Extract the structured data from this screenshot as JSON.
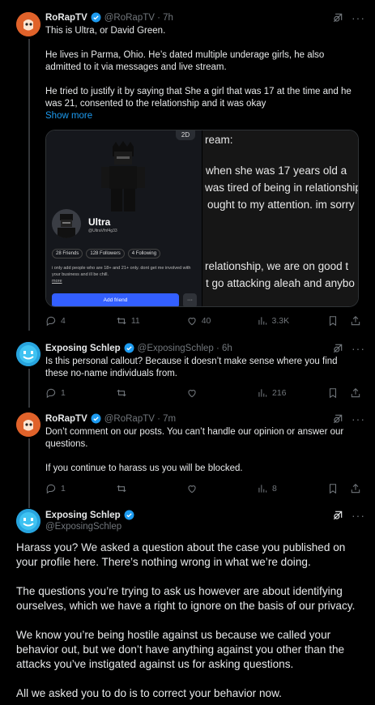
{
  "tweets": [
    {
      "author": "RoRapTV",
      "handle": "@RoRapTV · 7h",
      "text": "This is Ultra, or David Green.\n\nHe lives in Parma, Ohio. He’s dated multiple underage girls, he also admitted to it via messages and live stream.\n\nHe tried to justify it by saying that She a girl that was 17 at the time and he was 21, consented to the relationship and it was okay",
      "show_more": "Show more",
      "stats": {
        "replies": "4",
        "reposts": "11",
        "likes": "40",
        "views": "3.3K"
      }
    },
    {
      "author": "Exposing Schlep",
      "handle": "@ExposingSchlep · 6h",
      "text": "Is this personal callout? Because it doesn’t make sense where you find these no-name individuals from.",
      "stats": {
        "replies": "1",
        "reposts": "",
        "likes": "",
        "views": "216"
      }
    },
    {
      "author": "RoRapTV",
      "handle": "@RoRapTV · 7m",
      "text": "Don’t comment on our posts. You can’t handle our opinion or answer our questions.\n\nIf you continue to harass us you will be blocked.",
      "stats": {
        "replies": "1",
        "reposts": "",
        "likes": "",
        "views": "8"
      }
    },
    {
      "author": "Exposing Schlep",
      "handle": "@ExposingSchlep",
      "text": "Harass you? We asked a question about the case you published on your profile here. There’s nothing wrong in what we’re doing.\n\nThe questions you’re trying to ask us however are about identifying ourselves, which we have a right to ignore on the basis of our privacy.\n\nWe know you’re being hostile against us because we called your behavior out, but we don’t have anything against you other than the attacks you’ve instigated against us for asking questions.\n\nAll we asked you to do is to correct your behavior now."
    }
  ],
  "media": {
    "badge_2d": "2D",
    "profile_name": "Ultra",
    "profile_handle": "@UltraVfnf4g33",
    "friends": "28 Friends",
    "followers": "128 Followers",
    "following": "4 Following",
    "bio": "i only add people who are 18+ and 21+ only. dont get me involved with your business and ill be chill.",
    "bio_more": "more",
    "add_friend": "Add friend",
    "ellipsis": "···",
    "right_lines": [
      "ream:",
      "when she was 17 years old a",
      "was tired of being in relationship",
      "ought to my attention. im sorry",
      "relationship, we are on good t",
      "t go attacking aleah and anybo"
    ]
  },
  "colors": {
    "accent": "#1d9bf0",
    "muted": "#71767b",
    "bg": "#000000"
  }
}
